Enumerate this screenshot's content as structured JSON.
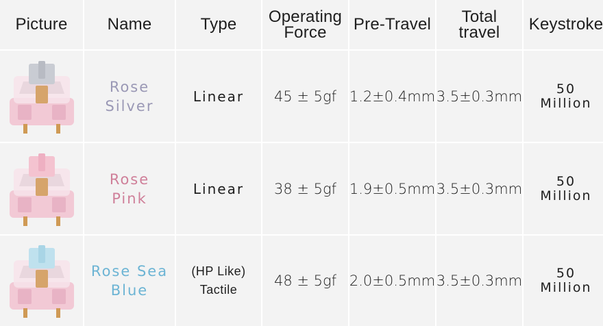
{
  "headers": {
    "picture": "Picture",
    "name": "Name",
    "type": "Type",
    "force_l1": "Operating",
    "force_l2": "Force",
    "pretravel": "Pre-Travel",
    "total_l1": "Total",
    "total_l2": "travel",
    "keystroke": "Keystroke"
  },
  "rows": [
    {
      "name_l1": "Rose",
      "name_l2": "Silver",
      "name_color": "#9a98b5",
      "stem_color": "#c9ccd3",
      "type_l1": "Linear",
      "type_l2": "",
      "force": "45 ± 5gf",
      "pretravel": "1.2±0.4mm",
      "total": "3.5±0.3mm",
      "keystroke_l1": "50",
      "keystroke_l2": "Million"
    },
    {
      "name_l1": "Rose",
      "name_l2": "Pink",
      "name_color": "#cf7f99",
      "stem_color": "#f4c3d0",
      "type_l1": "Linear",
      "type_l2": "",
      "force": "38 ± 5gf",
      "pretravel": "1.9±0.5mm",
      "total": "3.5±0.3mm",
      "keystroke_l1": "50",
      "keystroke_l2": "Million"
    },
    {
      "name_l1": "Rose Sea",
      "name_l2": "Blue",
      "name_color": "#6cb4d4",
      "stem_color": "#bfe1ee",
      "type_l1": "(HP Like)",
      "type_l2": "Tactile",
      "force": "48 ± 5gf",
      "pretravel": "2.0±0.5mm",
      "total": "3.5±0.3mm",
      "keystroke_l1": "50",
      "keystroke_l2": "Million"
    }
  ]
}
